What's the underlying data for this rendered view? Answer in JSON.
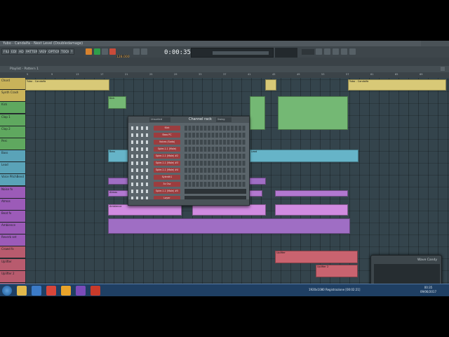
{
  "window": {
    "title": "Yubo - Candalfa - Next Level (Doubledamage)"
  },
  "menu": [
    "FILE",
    "EDIT",
    "ADD",
    "PATTERNS",
    "VIEW",
    "OPTIONS",
    "TOOLS",
    "?"
  ],
  "transport": {
    "time": "0:00:35",
    "time_unit": "M:S:CS",
    "tempo": "128.000",
    "pattern": "Pattern 1"
  },
  "playlist": {
    "title": "Playlist - Pattern 1"
  },
  "ruler": [
    "5",
    "9",
    "13",
    "17",
    "21",
    "25",
    "29",
    "33",
    "37",
    "41",
    "45",
    "49",
    "53",
    "57",
    "61",
    "65",
    "69"
  ],
  "tracks": [
    {
      "name": "Chord",
      "color": "#c9b35a"
    },
    {
      "name": "Synth Crash",
      "color": "#c9b35a"
    },
    {
      "name": "Kick",
      "color": "#5fa85f"
    },
    {
      "name": "Clap 1",
      "color": "#5fa85f"
    },
    {
      "name": "Clap 2",
      "color": "#5fa85f"
    },
    {
      "name": "Perc",
      "color": "#5fa85f"
    },
    {
      "name": "Bass",
      "color": "#5aa3b8"
    },
    {
      "name": "Lead",
      "color": "#5aa3b8"
    },
    {
      "name": "Voice PitchBend",
      "color": "#5aa3b8"
    },
    {
      "name": "Noise fx",
      "color": "#9c5bb8"
    },
    {
      "name": "Atmos",
      "color": "#9c5bb8"
    },
    {
      "name": "Beat fx",
      "color": "#9c5bb8"
    },
    {
      "name": "Ambience",
      "color": "#9c5bb8"
    },
    {
      "name": "Reverb set",
      "color": "#9c5bb8"
    },
    {
      "name": "Crowd fx",
      "color": "#b85b6e"
    },
    {
      "name": "Uplifter",
      "color": "#b85b6e"
    },
    {
      "name": "Uplifter 2",
      "color": "#b85b6e"
    },
    {
      "name": "Down fx",
      "color": "#b85b6e"
    }
  ],
  "clips": [
    {
      "label": "Yubo - Candalfa",
      "color": "#d8c977"
    },
    {
      "label": "Yubo - Candalfa",
      "color": "#d8c977"
    },
    {
      "label": "Kick",
      "color": "#74b874"
    },
    {
      "label": "Bass",
      "color": "#66b4c8"
    },
    {
      "label": "Lead",
      "color": "#66b4c8"
    },
    {
      "label": "Atmos",
      "color": "#b278d0"
    },
    {
      "label": "Ambience",
      "color": "#d08be0"
    },
    {
      "label": "Uplifter",
      "color": "#c9636f"
    },
    {
      "label": "Uplifter 2",
      "color": "#c9636f"
    }
  ],
  "channel_rack": {
    "title": "Channel rack",
    "swing": "Unsorted",
    "group": "Swing",
    "channels": [
      "Kick",
      "Bass PC",
      "Voices (Soda)",
      "Spire-1.1 (Male)",
      "Spire-1.1 (Male) #2",
      "Spire-1.1 (Male) #3",
      "Spire-1.1 (Male) #4",
      "Sylenth1",
      "3x Osc",
      "Spire-1.1 (Male) #5",
      "Layer"
    ]
  },
  "mixer": {
    "title": "Wave Candy"
  },
  "taskbar": {
    "tray": "1920x1080 Registrazione [00:02:21]",
    "time": "00:35",
    "date": "09/06/2017"
  }
}
